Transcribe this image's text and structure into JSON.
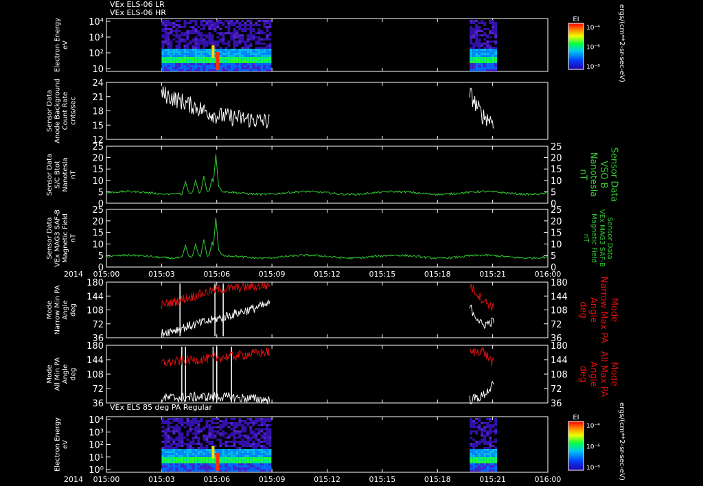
{
  "colors": {
    "background": "#000000",
    "axes": "#ffffff",
    "white_trace": "#ffffff",
    "green_trace": "#33cc33",
    "red_trace": "#dd1111"
  },
  "chart_data": [
    {
      "type": "heatmap",
      "title_lines": [
        "VEx ELS-06 LR",
        "VEx ELS-06 HR"
      ],
      "ylabel": [
        "Electron Energy",
        "eV"
      ],
      "yscale": "log",
      "yticks": [
        "10",
        "10²",
        "10³",
        "10⁴"
      ],
      "colorbar": {
        "title": "EI",
        "ticks": [
          "10⁻⁴",
          "10⁻⁶",
          "10⁻⁸"
        ],
        "units": "ergs/(cm**2-sr-sec-eV)"
      },
      "x_time_ranges": [
        [
          "015:03:00",
          "015:09:00"
        ],
        [
          "015:19:45",
          "015:21:15"
        ]
      ]
    },
    {
      "type": "line",
      "ylabel": [
        "Sensor Data",
        "Anode Background",
        "Count Rate",
        "cnts/sec"
      ],
      "yticks": [
        "12",
        "15",
        "18",
        "21",
        "24"
      ],
      "ylim": [
        11,
        24
      ],
      "series": [
        {
          "segments": [
            {
              "t_start": 3.0,
              "t_end": 8.9,
              "start": 21.5,
              "mid": 16.5,
              "end": 15.0
            },
            {
              "t_start": 19.75,
              "t_end": 21.1,
              "start": 21.5,
              "mid": 16.5,
              "end": 15.0
            }
          ]
        }
      ]
    },
    {
      "type": "line",
      "ylabel": [
        "Sensor Data",
        "S/C Btot",
        "Nanotesla",
        "nT"
      ],
      "right_label": [
        "Sensor Data",
        "VSO B",
        "Nanotesla",
        "nT"
      ],
      "yticks": [
        "0",
        "5",
        "10",
        "15",
        "20",
        "25"
      ],
      "ylim": [
        0,
        25
      ],
      "series": [
        {
          "base": 4.5,
          "gap": [
            3.5,
            3.95
          ],
          "spikes": [
            {
              "t": 4.3,
              "v": 9.5
            },
            {
              "t": 4.85,
              "v": 10
            },
            {
              "t": 5.3,
              "v": 12
            },
            {
              "t": 5.75,
              "v": 11
            },
            {
              "t": 5.95,
              "v": 21.5
            },
            {
              "t": 6.15,
              "v": 7
            }
          ]
        }
      ]
    },
    {
      "type": "line",
      "ylabel": [
        "Sensor Data",
        "VEx MAG3 SAF-B",
        "Magnetic Field",
        "nT"
      ],
      "right_label": [
        "Sensor Data",
        "VEx MAG3 SAF-B",
        "Magnetic Field",
        "nT"
      ],
      "yticks": [
        "0",
        "5",
        "10",
        "15",
        "20",
        "25"
      ],
      "ylim": [
        0,
        25
      ],
      "series": [
        {
          "base": 4.5,
          "spikes": [
            {
              "t": 4.3,
              "v": 9.5
            },
            {
              "t": 4.85,
              "v": 10
            },
            {
              "t": 5.3,
              "v": 12
            },
            {
              "t": 5.75,
              "v": 11
            },
            {
              "t": 5.95,
              "v": 21.5
            },
            {
              "t": 6.15,
              "v": 7
            }
          ]
        }
      ]
    },
    {
      "type": "line",
      "ylabel": [
        "Mode",
        "Narrow Min PA",
        "Angle",
        "deg"
      ],
      "right_label": [
        "Mode",
        "Narrow Max PA",
        "Angle",
        "deg"
      ],
      "yticks": [
        "36",
        "72",
        "108",
        "144",
        "180"
      ],
      "ylim": [
        0,
        180
      ],
      "series": [
        {
          "segments": [
            {
              "t_start": 3.0,
              "t_end": 8.9,
              "start": 15,
              "mid": 60,
              "end": 110
            },
            {
              "t_start": 19.75,
              "t_end": 21.1,
              "start": 100,
              "mid": 40,
              "end": 55
            }
          ],
          "spikes_up": [
            4.0,
            5.9,
            6.35
          ]
        },
        {
          "segments": [
            {
              "t_start": 3.0,
              "t_end": 8.9,
              "start": 105,
              "mid": 155,
              "end": 170
            },
            {
              "t_start": 19.75,
              "t_end": 21.1,
              "start": 170,
              "mid": 125,
              "end": 95
            }
          ]
        }
      ]
    },
    {
      "type": "line",
      "ylabel": [
        "Mode",
        "All Min PA",
        "Angle",
        "deg"
      ],
      "right_label": [
        "Mode",
        "All Max PA",
        "Angle",
        "deg"
      ],
      "yticks": [
        "36",
        "72",
        "108",
        "144",
        "180"
      ],
      "ylim": [
        0,
        180
      ],
      "series": [
        {
          "segments": [
            {
              "t_start": 3.0,
              "t_end": 8.9,
              "start": 15,
              "mid": 20,
              "end": 10
            },
            {
              "t_start": 19.75,
              "t_end": 21.1,
              "start": 10,
              "mid": 20,
              "end": 60
            }
          ],
          "spikes_up": [
            4.1,
            4.3,
            5.8,
            6.0,
            6.8
          ]
        },
        {
          "segments": [
            {
              "t_start": 3.0,
              "t_end": 8.9,
              "start": 125,
              "mid": 140,
              "end": 160
            },
            {
              "t_start": 19.75,
              "t_end": 21.1,
              "start": 155,
              "mid": 165,
              "end": 120
            }
          ]
        }
      ]
    },
    {
      "type": "heatmap",
      "title_lines": [
        "VEx ELS 85 deg PA Regular"
      ],
      "ylabel": [
        "Electron Energy",
        "eV"
      ],
      "yscale": "log",
      "yticks": [
        "10⁰",
        "10¹",
        "10²",
        "10³",
        "10⁴"
      ],
      "colorbar": {
        "title": "EI",
        "ticks": [
          "10⁻⁴",
          "10⁻⁶",
          "10⁻⁸"
        ],
        "units": "ergs/(cm**2-sr-sec-eV)"
      },
      "x_time_ranges": [
        [
          "015:03:00",
          "015:09:00"
        ],
        [
          "015:19:45",
          "015:21:15"
        ]
      ]
    }
  ],
  "x_axis": {
    "year": "2014",
    "tick_labels": [
      "015:00",
      "015:03",
      "015:06",
      "015:09",
      "015:12",
      "015:15",
      "015:18",
      "015:21",
      "016:00"
    ],
    "range_minutes": [
      0,
      24
    ]
  }
}
